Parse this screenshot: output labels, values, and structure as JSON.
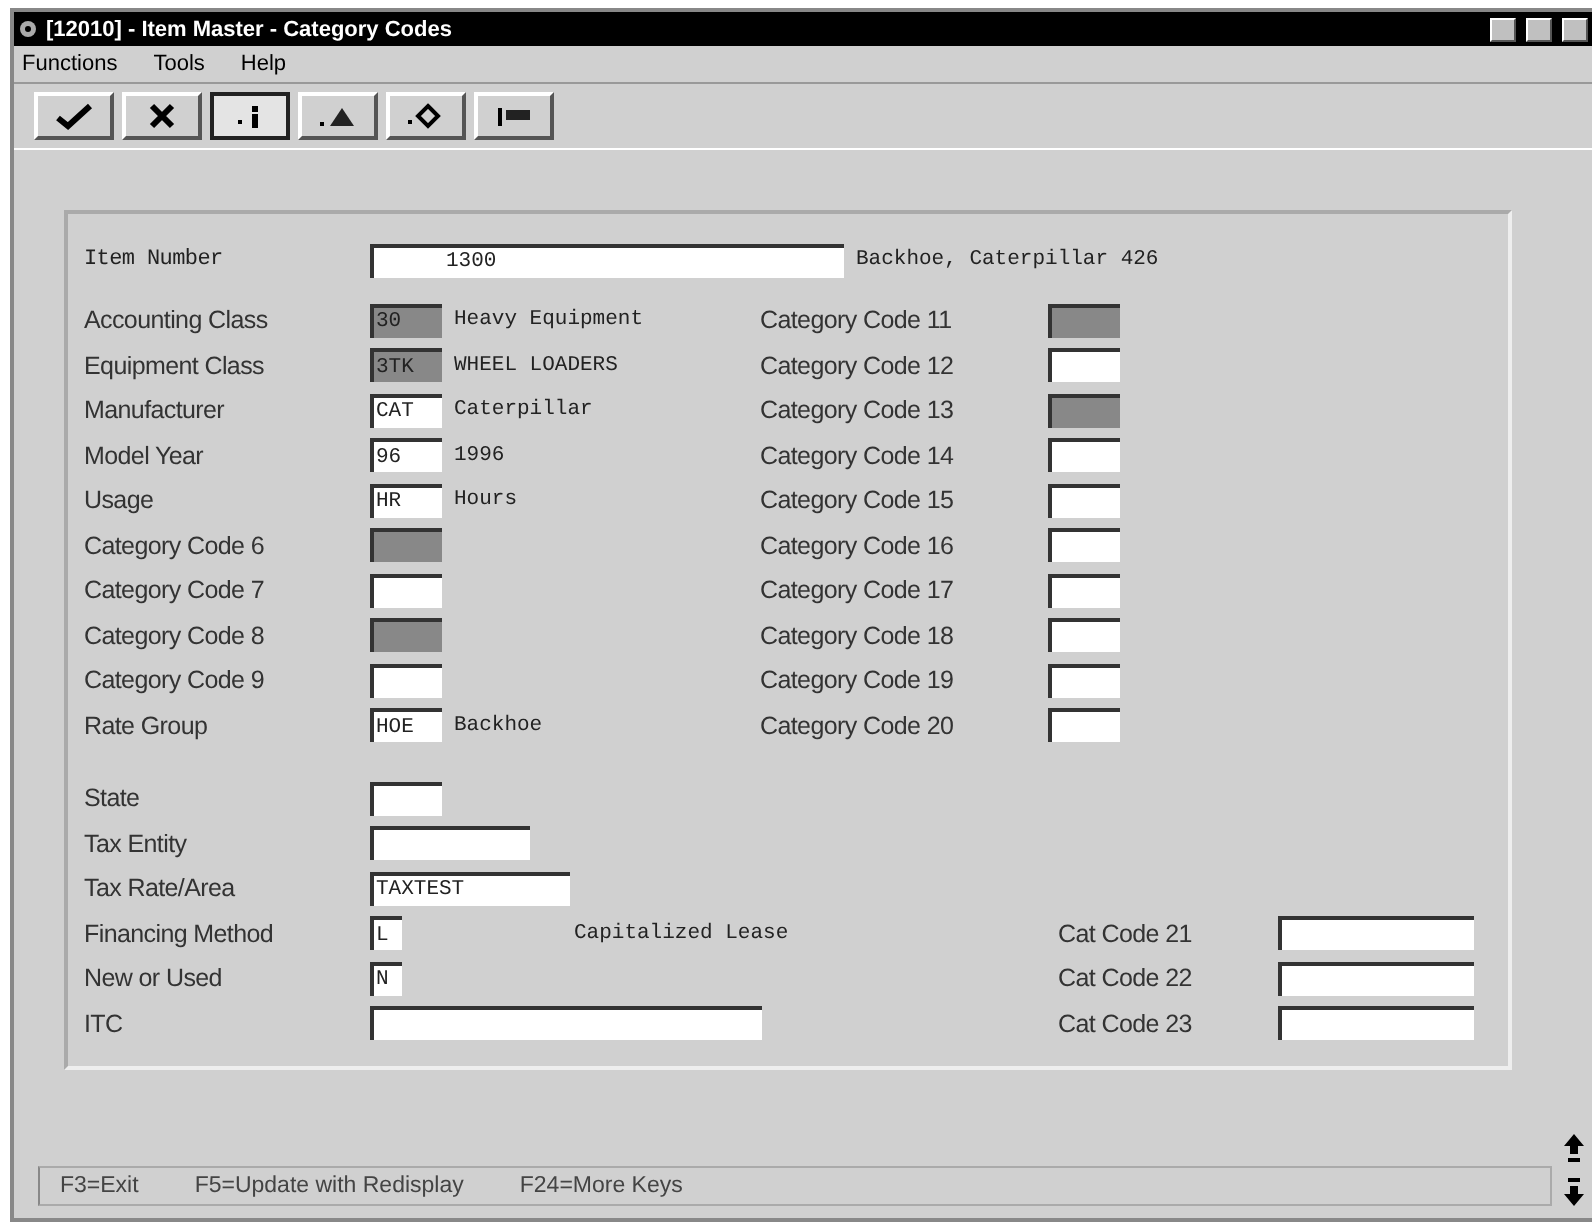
{
  "window": {
    "title": "[12010] - Item Master - Category Codes"
  },
  "menu": [
    {
      "label": "Functions"
    },
    {
      "label": "Tools"
    },
    {
      "label": "Help"
    }
  ],
  "toolbar": [
    {
      "kind": "check",
      "selected": false
    },
    {
      "kind": "cancel",
      "selected": false
    },
    {
      "kind": "inquire",
      "selected": true
    },
    {
      "kind": "add",
      "selected": false
    },
    {
      "kind": "change",
      "selected": false
    },
    {
      "kind": "delete",
      "selected": false
    }
  ],
  "item_number": {
    "label": "Item Number",
    "value": "1300",
    "description": "Backhoe, Caterpillar 426"
  },
  "left_fields": [
    {
      "label": "Accounting Class",
      "value": "30",
      "description": "Heavy Equipment",
      "shaded": true
    },
    {
      "label": "Equipment Class",
      "value": "3TK",
      "description": "WHEEL LOADERS",
      "shaded": true
    },
    {
      "label": "Manufacturer",
      "value": "CAT",
      "description": "Caterpillar",
      "shaded": false
    },
    {
      "label": "Model Year",
      "value": "96",
      "description": "1996",
      "shaded": false
    },
    {
      "label": "Usage",
      "value": "HR",
      "description": "Hours",
      "shaded": false
    },
    {
      "label": "Category Code 6",
      "shaded": true
    },
    {
      "label": "Category Code 7",
      "shaded": false
    },
    {
      "label": "Category Code 8",
      "shaded": true
    },
    {
      "label": "Category Code 9",
      "shaded": false
    },
    {
      "label": "Rate Group",
      "value": "HOE",
      "description": "Backhoe",
      "shaded": false
    }
  ],
  "right_fields": [
    {
      "label": "Category Code 11",
      "shaded": true
    },
    {
      "label": "Category Code 12",
      "shaded": false
    },
    {
      "label": "Category Code 13",
      "shaded": true
    },
    {
      "label": "Category Code 14",
      "shaded": false
    },
    {
      "label": "Category Code 15",
      "shaded": false
    },
    {
      "label": "Category Code 16",
      "shaded": false
    },
    {
      "label": "Category Code 17",
      "shaded": false
    },
    {
      "label": "Category Code 18",
      "shaded": false
    },
    {
      "label": "Category Code 19",
      "shaded": false
    },
    {
      "label": "Category Code 20",
      "shaded": false
    }
  ],
  "lower_fields": [
    {
      "label": "State"
    },
    {
      "label": "Tax Entity"
    },
    {
      "label": "Tax Rate/Area",
      "value": "TAXTEST"
    },
    {
      "label": "Financing Method",
      "value": "L",
      "description": "Capitalized Lease",
      "cat_label": "Cat Code 21"
    },
    {
      "label": "New or Used",
      "value": "N",
      "cat_label": "Cat Code 22"
    },
    {
      "label": "ITC",
      "cat_label": "Cat Code 23"
    }
  ],
  "status_bar": [
    {
      "label": "F3=Exit"
    },
    {
      "label": "F5=Update with Redisplay"
    },
    {
      "label": "F24=More Keys"
    }
  ]
}
